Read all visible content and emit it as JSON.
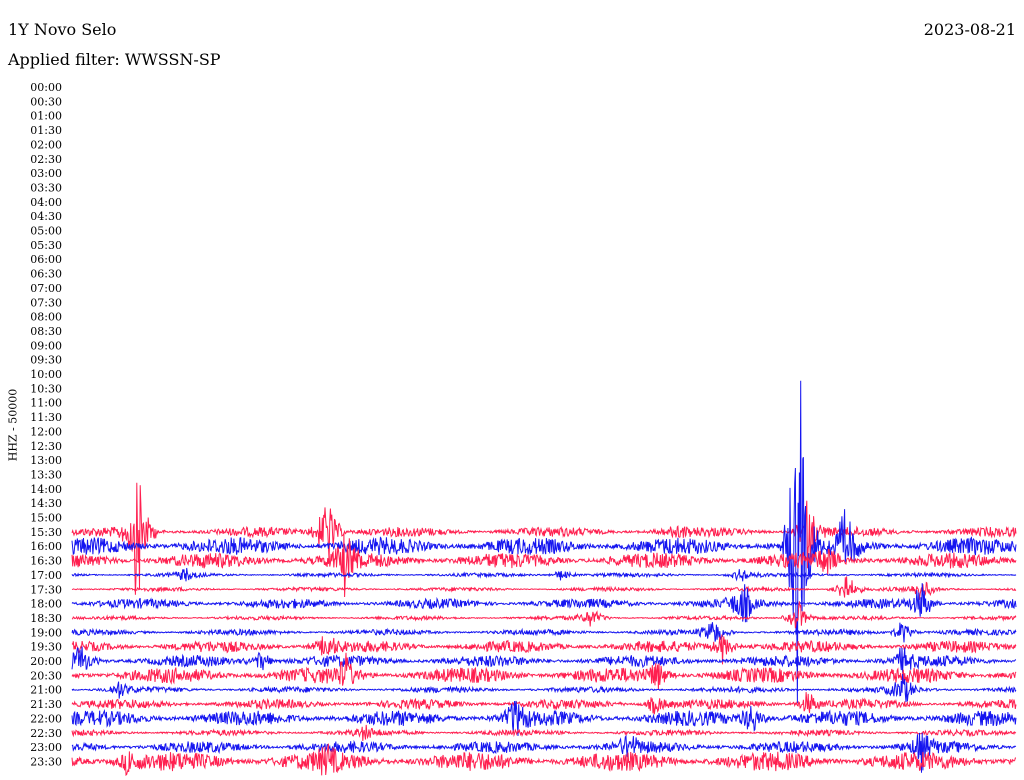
{
  "header": {
    "station": "1Y Novo Selo",
    "date": "2023-08-21",
    "filter": "Applied filter: WWSSN-SP"
  },
  "chart_data": {
    "type": "line",
    "title": "1Y Novo Selo",
    "ylabel": "HHZ - 50000",
    "colors": [
      "#ff1f4f",
      "#1515f0"
    ],
    "tick_labels": [
      "00:00",
      "00:30",
      "01:00",
      "01:30",
      "02:00",
      "02:30",
      "03:00",
      "03:30",
      "04:00",
      "04:30",
      "05:00",
      "05:30",
      "06:00",
      "06:30",
      "07:00",
      "07:30",
      "08:00",
      "08:30",
      "09:00",
      "09:30",
      "10:00",
      "10:30",
      "11:00",
      "11:30",
      "12:00",
      "12:30",
      "13:00",
      "13:30",
      "14:00",
      "14:30",
      "15:00",
      "15:30",
      "16:00",
      "16:30",
      "17:00",
      "17:30",
      "18:00",
      "18:30",
      "19:00",
      "19:30",
      "20:00",
      "20:30",
      "21:00",
      "21:30",
      "22:00",
      "22:30",
      "23:00",
      "23:30"
    ],
    "traces": [
      {
        "start": "15:30",
        "color": "red",
        "amplitude": 5,
        "events": [
          [
            0.07,
            70
          ],
          [
            0.27,
            40
          ],
          [
            0.64,
            6
          ],
          [
            0.78,
            30
          ]
        ]
      },
      {
        "start": "16:00",
        "color": "blue",
        "amplitude": 9,
        "events": [
          [
            0.77,
            150
          ],
          [
            0.82,
            30
          ]
        ]
      },
      {
        "start": "16:30",
        "color": "red",
        "amplitude": 8,
        "events": [
          [
            0.29,
            25
          ],
          [
            0.8,
            12
          ]
        ]
      },
      {
        "start": "17:00",
        "color": "blue",
        "amplitude": 2,
        "events": [
          [
            0.12,
            6
          ],
          [
            0.52,
            6
          ],
          [
            0.71,
            8
          ]
        ]
      },
      {
        "start": "17:30",
        "color": "red",
        "amplitude": 2,
        "events": [
          [
            0.82,
            18
          ],
          [
            0.9,
            12
          ]
        ]
      },
      {
        "start": "18:00",
        "color": "blue",
        "amplitude": 5,
        "events": [
          [
            0.71,
            20
          ],
          [
            0.9,
            18
          ]
        ]
      },
      {
        "start": "18:30",
        "color": "red",
        "amplitude": 2,
        "events": [
          [
            0.55,
            10
          ],
          [
            0.77,
            16
          ]
        ]
      },
      {
        "start": "19:00",
        "color": "blue",
        "amplitude": 3,
        "events": [
          [
            0.68,
            12
          ],
          [
            0.88,
            10
          ]
        ]
      },
      {
        "start": "19:30",
        "color": "red",
        "amplitude": 6,
        "events": [
          [
            0.27,
            12
          ],
          [
            0.69,
            14
          ]
        ]
      },
      {
        "start": "20:00",
        "color": "blue",
        "amplitude": 6,
        "events": [
          [
            0.01,
            14
          ],
          [
            0.2,
            10
          ],
          [
            0.88,
            12
          ]
        ]
      },
      {
        "start": "20:30",
        "color": "red",
        "amplitude": 8,
        "events": [
          [
            0.29,
            14
          ],
          [
            0.62,
            14
          ]
        ]
      },
      {
        "start": "21:00",
        "color": "blue",
        "amplitude": 3,
        "events": [
          [
            0.05,
            8
          ],
          [
            0.88,
            14
          ]
        ]
      },
      {
        "start": "21:30",
        "color": "red",
        "amplitude": 5,
        "events": [
          [
            0.62,
            12
          ],
          [
            0.78,
            12
          ]
        ]
      },
      {
        "start": "22:00",
        "color": "blue",
        "amplitude": 8,
        "events": [
          [
            0.47,
            16
          ],
          [
            0.72,
            16
          ]
        ]
      },
      {
        "start": "22:30",
        "color": "red",
        "amplitude": 3,
        "events": [
          [
            0.31,
            6
          ]
        ]
      },
      {
        "start": "23:00",
        "color": "blue",
        "amplitude": 6,
        "events": [
          [
            0.59,
            10
          ],
          [
            0.9,
            16
          ]
        ]
      },
      {
        "start": "23:30",
        "color": "red",
        "amplitude": 10,
        "events": [
          [
            0.06,
            12
          ],
          [
            0.27,
            10
          ]
        ]
      }
    ]
  }
}
